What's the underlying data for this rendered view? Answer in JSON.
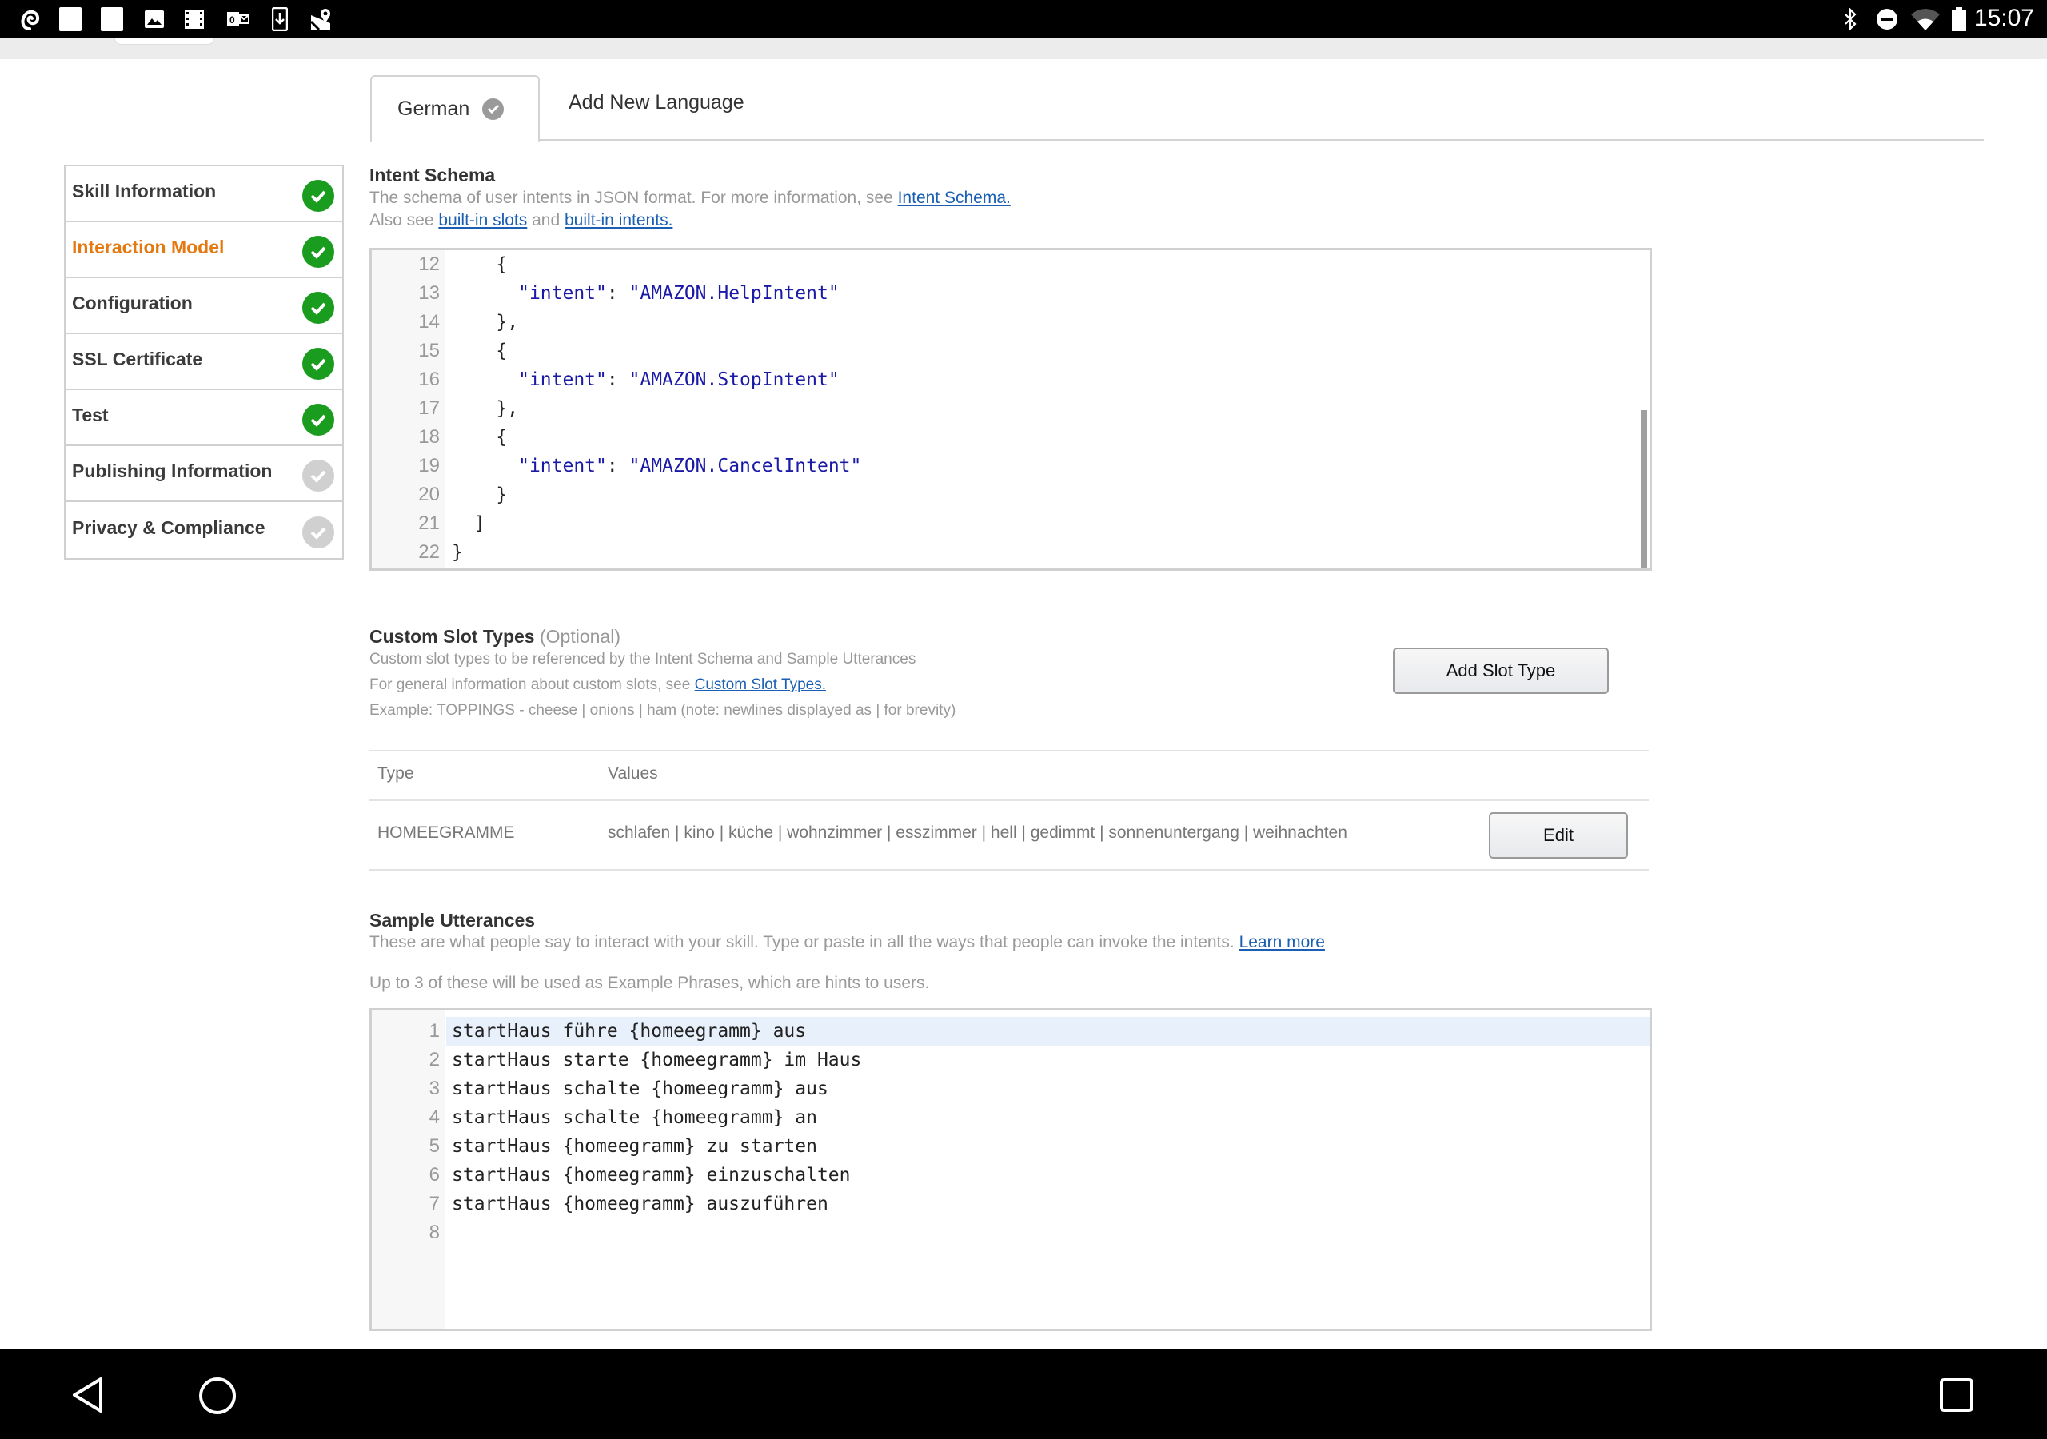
{
  "status_bar": {
    "time": "15:07",
    "left_icons": [
      "app-swirl-icon",
      "blank-notification-icon",
      "blank-notification-icon",
      "image-icon",
      "film-icon",
      "outlook-icon",
      "download-icon",
      "maps-icon"
    ],
    "right_icons": [
      "bluetooth-icon",
      "do-not-disturb-icon",
      "wifi-icon",
      "battery-icon"
    ]
  },
  "language_tabs": {
    "active": "German",
    "add": "Add New Language"
  },
  "sidebar": {
    "items": [
      {
        "label": "Skill Information",
        "status": "complete",
        "active": false
      },
      {
        "label": "Interaction Model",
        "status": "complete",
        "active": true
      },
      {
        "label": "Configuration",
        "status": "complete",
        "active": false
      },
      {
        "label": "SSL Certificate",
        "status": "complete",
        "active": false
      },
      {
        "label": "Test",
        "status": "complete",
        "active": false
      },
      {
        "label": "Publishing Information",
        "status": "incomplete",
        "active": false
      },
      {
        "label": "Privacy & Compliance",
        "status": "incomplete",
        "active": false
      }
    ]
  },
  "intent_schema": {
    "title": "Intent Schema",
    "desc_prefix": "The schema of user intents in JSON format. For more information, see ",
    "desc_link": "Intent Schema.",
    "also_prefix": "Also see ",
    "slots_link": "built-in slots",
    "and_text": " and ",
    "intents_link": "built-in intents.",
    "lines": [
      {
        "n": "12",
        "indent": "    ",
        "key": "",
        "sep": "",
        "val": "",
        "rest": "{"
      },
      {
        "n": "13",
        "indent": "      ",
        "key": "\"intent\"",
        "sep": ": ",
        "val": "\"AMAZON.HelpIntent\"",
        "rest": ""
      },
      {
        "n": "14",
        "indent": "    ",
        "key": "",
        "sep": "",
        "val": "",
        "rest": "},"
      },
      {
        "n": "15",
        "indent": "    ",
        "key": "",
        "sep": "",
        "val": "",
        "rest": "{"
      },
      {
        "n": "16",
        "indent": "      ",
        "key": "\"intent\"",
        "sep": ": ",
        "val": "\"AMAZON.StopIntent\"",
        "rest": ""
      },
      {
        "n": "17",
        "indent": "    ",
        "key": "",
        "sep": "",
        "val": "",
        "rest": "},"
      },
      {
        "n": "18",
        "indent": "    ",
        "key": "",
        "sep": "",
        "val": "",
        "rest": "{"
      },
      {
        "n": "19",
        "indent": "      ",
        "key": "\"intent\"",
        "sep": ": ",
        "val": "\"AMAZON.CancelIntent\"",
        "rest": ""
      },
      {
        "n": "20",
        "indent": "    ",
        "key": "",
        "sep": "",
        "val": "",
        "rest": "}"
      },
      {
        "n": "21",
        "indent": "  ",
        "key": "",
        "sep": "",
        "val": "",
        "rest": "]"
      },
      {
        "n": "22",
        "indent": "",
        "key": "",
        "sep": "",
        "val": "",
        "rest": "}"
      }
    ]
  },
  "custom_slots": {
    "title": "Custom Slot Types",
    "optional": "(Optional)",
    "desc1": "Custom slot types to be referenced by the Intent Schema and Sample Utterances",
    "desc2_prefix": "For general information about custom slots, see ",
    "desc2_link": "Custom Slot Types.",
    "desc3": "Example: TOPPINGS - cheese | onions | ham (note: newlines displayed as | for brevity)",
    "add_button": "Add Slot Type",
    "columns": [
      "Type",
      "Values"
    ],
    "rows": [
      {
        "type": "HOMEEGRAMME",
        "values": "schlafen | kino | küche | wohnzimmer | esszimmer | hell | gedimmt | sonnenuntergang | weihnachten",
        "edit_label": "Edit"
      }
    ]
  },
  "sample_utterances": {
    "title": "Sample Utterances",
    "desc_prefix": "These are what people say to interact with your skill. Type or paste in all the ways that people can invoke the intents. ",
    "desc_link": "Learn more",
    "hint": "Up to 3 of these will be used as Example Phrases, which are hints to users.",
    "lines": [
      {
        "n": "1",
        "text": "startHaus führe {homeegramm} aus"
      },
      {
        "n": "2",
        "text": "startHaus starte {homeegramm} im Haus"
      },
      {
        "n": "3",
        "text": "startHaus schalte {homeegramm} aus"
      },
      {
        "n": "4",
        "text": "startHaus schalte {homeegramm} an"
      },
      {
        "n": "5",
        "text": "startHaus {homeegramm} zu starten"
      },
      {
        "n": "6",
        "text": "startHaus {homeegramm} einzuschalten"
      },
      {
        "n": "7",
        "text": "startHaus {homeegramm} auszuführen"
      },
      {
        "n": "8",
        "text": ""
      }
    ]
  },
  "nav_bar": {
    "buttons": [
      "back",
      "home",
      "recents"
    ]
  },
  "colors": {
    "active_nav": "#e47911",
    "complete": "#1a9c1f",
    "incomplete": "#d0d0d0",
    "link": "#1a5fb4",
    "json_string": "#1a1aa6"
  }
}
